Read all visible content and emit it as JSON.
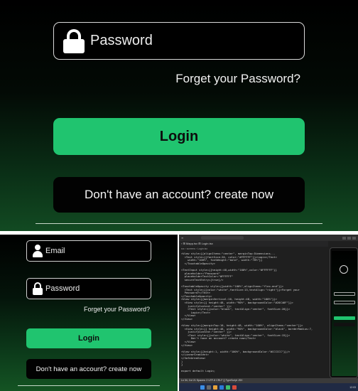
{
  "top": {
    "password_placeholder": "Password",
    "forget_link": "Forget your Password?",
    "login_label": "Login",
    "create_account_label": "Don't have an account? create now"
  },
  "phone_app": {
    "email_placeholder": "Email",
    "password_placeholder": "Password",
    "forget_link": "Forget your Password?",
    "login_label": "Login",
    "create_account_label": "Don't have an account? create now"
  },
  "ide": {
    "tabs": "› ⊞ Mapp.tsx  ⊞ Login.tsx",
    "breadcrumb": "src › screens › Login.tsx",
    "code_lines": [
      "<View style={{alignItems:\"center\", marginTop:Dimensions...",
      "  <Text style={{fontSize:20, color:\"#FFFFFF\"}}>Login</Text>",
      "    width:\"100%\", fontWeight:\"bold\", width:\"70%\"}}",
      "  </TouchableOpacity>",
      "",
      "<TextInput style={{height:48,width:\"100%\",color:\"#FFFFFF\"}}",
      "  placeholder=\"Password\"",
      "  placeholderTextColor=\"#FFFFFF\"",
      "  secureTextEntry={true}/>",
      "",
      "<TouchableOpacity style={{width:\"100%\",alignItems:\"flex-end\"}}>",
      "  <Text style={{color:\"white\",fontSize:13,textAlign:\"right\"}}>Forget your",
      "  Password?</Text>",
      "</TouchableOpacity>",
      "<View style={{marginVertical:10, height:48, width:\"100%\"}}>",
      "  <View style={{ height:48, width:\"90%\", backgroundColor:\"#20C46F\"}}>",
      "    justifyContent:\"center\" }}>",
      "    <Text style={{color:\"black\", textAlign:\"center\", fontSize:20}}>",
      "      Login</Text>",
      "  </View>",
      "</View>",
      "",
      "<View style={{marginTop:10, height:48, width:\"100%\", alignItems:\"center\"}}>",
      "  <View style={{ height:48, width:\"90%\", backgroundColor:\"black\", borderRadius:7,",
      "    justifyContent:\"center\" }}>",
      "    <Text style={{color:\"white\", textAlign:\"center\", fontSize:15}}>",
      "      Don't have an account? create now</Text>",
      "  </View>",
      "</View>",
      "",
      "<View style={{height:1, width:\"100%\", backgroundColor:\"#CCCCCC\"}}/>",
      "</LinearGradient>",
      "</SafeAreaView>",
      ")",
      "}",
      "",
      "export default Login;"
    ],
    "status": "Ln 34, Col 21  Spaces: 2  UTF-8  CRLF  {} TypeScript JSX",
    "clock": "12:03"
  },
  "colors": {
    "accent_green": "#20C46F",
    "field_border": "#D9D9D9",
    "dark_bg": "#000000"
  }
}
